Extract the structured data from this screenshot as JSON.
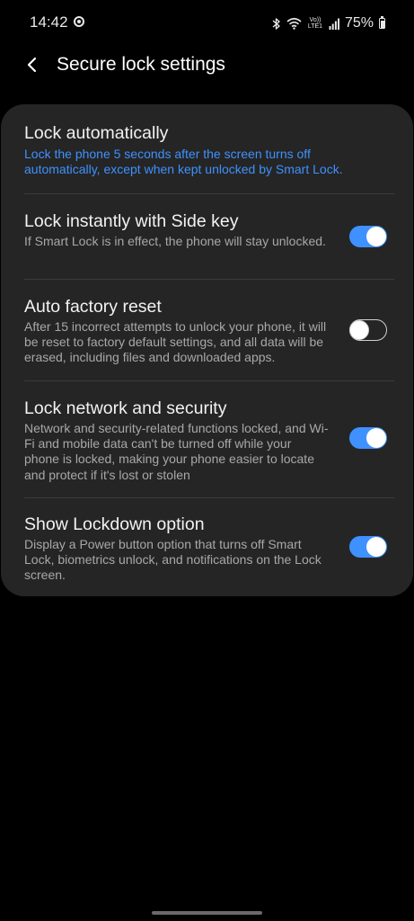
{
  "status_bar": {
    "time": "14:42",
    "network_label": "Vo)) LTE1",
    "battery": "75%",
    "battery_level": 0.75,
    "icons": [
      "notification-icon",
      "bluetooth-icon",
      "wifi-icon",
      "volte-icon",
      "signal-icon",
      "battery-icon"
    ]
  },
  "app_bar": {
    "back_icon": "back-chevron-icon",
    "title": "Secure lock settings"
  },
  "settings": [
    {
      "id": "lock-automatically",
      "title": "Lock automatically",
      "description": "Lock the phone 5 seconds after the screen turns off automatically, except when kept unlocked by Smart Lock."
    },
    {
      "id": "lock-instantly-side-key",
      "title": "Lock instantly with Side key",
      "description": "If Smart Lock is in effect, the phone will stay unlocked.",
      "toggle_on": true
    },
    {
      "id": "auto-factory-reset",
      "title": "Auto factory reset",
      "description": "After 15 incorrect attempts to unlock your phone, it will be reset to factory default settings, and all data will be erased, including files and downloaded apps.",
      "toggle_on": false
    },
    {
      "id": "lock-network-security",
      "title": "Lock network and security",
      "description": "Network and security-related functions locked, and Wi-Fi and mobile data can't be turned off while your phone is locked, making your phone easier to locate and protect if it's lost or stolen",
      "toggle_on": true
    },
    {
      "id": "show-lockdown-option",
      "title": "Show Lockdown option",
      "description": "Display a Power button option that turns off Smart Lock, biometrics unlock, and notifications on the Lock screen.",
      "toggle_on": true
    }
  ],
  "colors": {
    "background": "#000000",
    "card": "#252525",
    "accent": "#3e91ff",
    "title_text": "#f2f2f2",
    "secondary_text": "#a8a8a8"
  }
}
